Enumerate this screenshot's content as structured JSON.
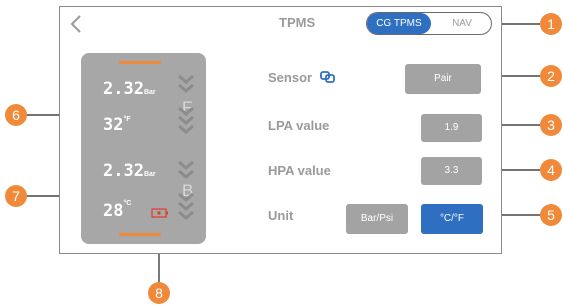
{
  "header": {
    "title": "TPMS",
    "toggle": {
      "options": [
        "CG TPMS",
        "NAV"
      ],
      "selected": "CG TPMS"
    }
  },
  "tires": {
    "front": {
      "pressure": "2.32",
      "pressure_unit": "Bar",
      "temperature": "32",
      "temperature_unit": "°F",
      "position_letter": "F"
    },
    "back": {
      "pressure": "2.32",
      "pressure_unit": "Bar",
      "temperature": "28",
      "temperature_unit": "°C",
      "position_letter": "B"
    }
  },
  "settings": {
    "sensor": {
      "label": "Sensor",
      "button": "Pair"
    },
    "lpa": {
      "label": "LPA value",
      "value": "1.9"
    },
    "hpa": {
      "label": "HPA value",
      "value": "3.3"
    },
    "unit": {
      "label": "Unit",
      "options": [
        "Bar/Psi",
        "°C/°F"
      ],
      "selected": "°C/°F"
    }
  },
  "callouts": [
    "1",
    "2",
    "3",
    "4",
    "5",
    "6",
    "7",
    "8"
  ],
  "colors": {
    "accent": "#2f6fc2",
    "callout": "#f08a3a",
    "battery": "#e23a2c",
    "card": "#a7a7a7",
    "button": "#a3a3a3"
  },
  "icons": {
    "back": "chevron-left-icon",
    "sensor": "link-icon",
    "battery": "battery-low-icon",
    "tread": "chevron-down-icon"
  }
}
